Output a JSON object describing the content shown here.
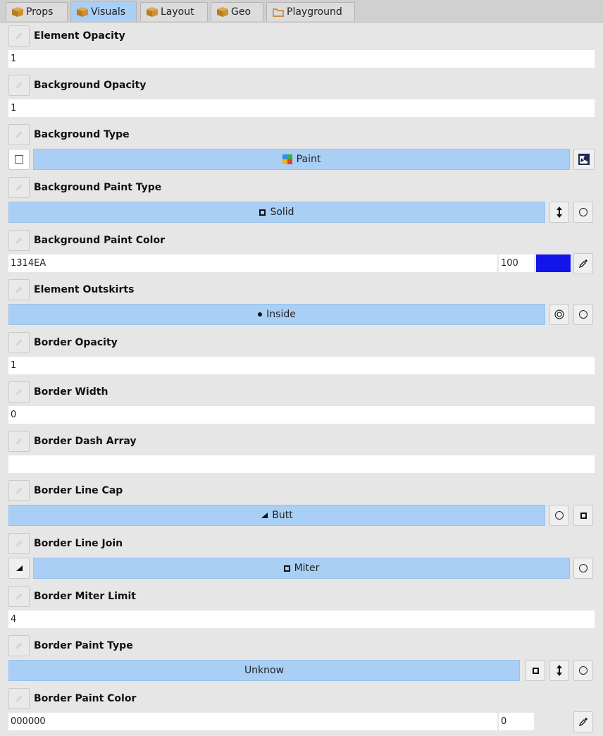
{
  "tabs": [
    {
      "label": "Props",
      "icon": "package-icon"
    },
    {
      "label": "Visuals",
      "icon": "package-icon"
    },
    {
      "label": "Layout",
      "icon": "package-icon"
    },
    {
      "label": "Geo",
      "icon": "package-icon"
    },
    {
      "label": "Playground",
      "icon": "folder-icon"
    }
  ],
  "active_tab": "Visuals",
  "properties": {
    "element_opacity": {
      "label": "Element Opacity",
      "value": "1"
    },
    "background_opacity": {
      "label": "Background Opacity",
      "value": "1"
    },
    "background_type": {
      "label": "Background Type",
      "value": "Paint",
      "checkbox_checked": false
    },
    "background_paint_type": {
      "label": "Background Paint Type",
      "value": "Solid"
    },
    "background_paint_color": {
      "label": "Background Paint Color",
      "hex": "1314EA",
      "alpha": "100",
      "swatch_color": "#1314EA"
    },
    "element_outskirts": {
      "label": "Element Outskirts",
      "value": "Inside"
    },
    "border_opacity": {
      "label": "Border Opacity",
      "value": "1"
    },
    "border_width": {
      "label": "Border Width",
      "value": "0"
    },
    "border_dash_array": {
      "label": "Border Dash Array",
      "value": ""
    },
    "border_line_cap": {
      "label": "Border Line Cap",
      "value": "Butt"
    },
    "border_line_join": {
      "label": "Border Line Join",
      "value": "Miter"
    },
    "border_miter_limit": {
      "label": "Border Miter Limit",
      "value": "4"
    },
    "border_paint_type": {
      "label": "Border Paint Type",
      "value": "Unknow"
    },
    "border_paint_color": {
      "label": "Border Paint Color",
      "hex": "000000",
      "alpha": "0"
    }
  },
  "icons": [
    "pencil-icon",
    "arrows-vertical-icon",
    "circle-icon",
    "square-icon",
    "target-icon",
    "eyedropper-icon",
    "triangle-icon",
    "paint-grid-icon",
    "image-icon"
  ],
  "colors": {
    "bar": "#A9CFF5",
    "panel": "#E6E6E6",
    "field": "#FFFFFF"
  }
}
